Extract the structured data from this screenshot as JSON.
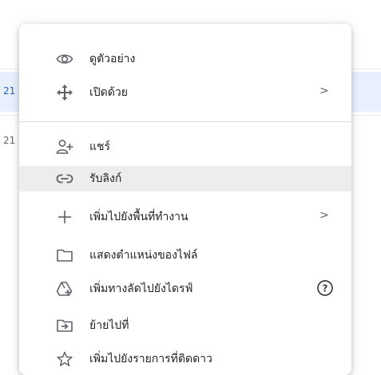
{
  "background_rows": [
    {
      "text": "21",
      "selected": true
    },
    {
      "text": "21",
      "selected": false
    }
  ],
  "menu": {
    "items": [
      {
        "label": "ดูตัวอย่าง",
        "icon": "eye-icon"
      },
      {
        "label": "เปิดด้วย",
        "icon": "move-arrows-icon",
        "submenu": ">"
      },
      {
        "label": "แชร์",
        "icon": "person-add-icon"
      },
      {
        "label": "รับลิงก์",
        "icon": "link-icon",
        "highlighted": true
      },
      {
        "label": "เพิ่มไปยังพื้นที่ทำงาน",
        "icon": "plus-icon",
        "submenu": ">"
      },
      {
        "label": "แสดงตำแหน่งของไฟล์",
        "icon": "folder-icon"
      },
      {
        "label": "เพิ่มทางลัดไปยังไดรฟ์",
        "icon": "drive-shortcut-icon",
        "help": "?"
      },
      {
        "label": "ย้ายไปที่",
        "icon": "move-to-folder-icon"
      },
      {
        "label": "เพิ่มไปยังรายการที่ติดดาว",
        "icon": "star-icon"
      }
    ]
  },
  "colors": {
    "highlight": "#ededed",
    "selected_row": "#e8f0fe",
    "icon": "#5f6368",
    "text": "#202124"
  }
}
